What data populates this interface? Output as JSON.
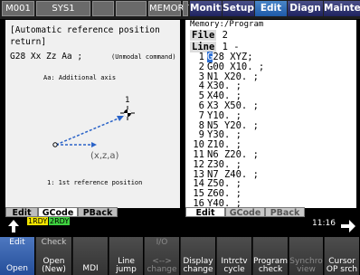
{
  "topbar": {
    "machine": "M001",
    "system": "SYS1",
    "memory": "MEMORY",
    "tabs": [
      "Monitr",
      "Setup",
      "Edit",
      "Diagn",
      "Mainte"
    ],
    "active_tab": "Edit"
  },
  "guide": {
    "title_line1": "[Automatic reference position",
    "title_line2": "return]",
    "syntax": "G28 Xx Zz Aa ;",
    "modal_note": "(Unmodal command)",
    "axis_note": "Aa: Additional axis",
    "point_label": "1",
    "coord_label": "(x,z,a)",
    "ref_note": "1: 1st reference position"
  },
  "program": {
    "header": "Memory:/Program",
    "file_label": "File",
    "file_value": "2",
    "line_label": "Line",
    "line_value": "1 -",
    "lines": [
      {
        "n": "1",
        "code": "G28 XYZ;"
      },
      {
        "n": "2",
        "code": "G00 X10. ;"
      },
      {
        "n": "3",
        "code": "N1 X20. ;"
      },
      {
        "n": "4",
        "code": "X30. ;"
      },
      {
        "n": "5",
        "code": "X40. ;"
      },
      {
        "n": "6",
        "code": "X3 X50. ;"
      },
      {
        "n": "7",
        "code": "Y10. ;"
      },
      {
        "n": "8",
        "code": "N5 Y20. ;"
      },
      {
        "n": "9",
        "code": "Y30. ;"
      },
      {
        "n": "10",
        "code": "Z10. ;"
      },
      {
        "n": "11",
        "code": "N6 Z20. ;"
      },
      {
        "n": "12",
        "code": "Z30. ;"
      },
      {
        "n": "13",
        "code": "N7 Z40. ;"
      },
      {
        "n": "14",
        "code": "Z50. ;"
      },
      {
        "n": "15",
        "code": "Z60. ;"
      },
      {
        "n": "16",
        "code": "Y40. ;"
      }
    ]
  },
  "left_tabs": [
    "Edit",
    "GCode",
    "PBack"
  ],
  "right_tabs": [
    "Edit",
    "GCode",
    "PBack"
  ],
  "status": {
    "rdy1": "1RDY",
    "rdy2": "2RDY",
    "time": "11:16"
  },
  "fkeys": [
    {
      "top": "Edit",
      "bottom": "Open"
    },
    {
      "top": "Check",
      "bottom": "Open (New)"
    },
    {
      "top": "",
      "bottom": "MDI"
    },
    {
      "top": "",
      "bottom": "Line jump"
    },
    {
      "top": "I/O",
      "bottom": "<--> change"
    },
    {
      "top": "",
      "bottom": "Display change"
    },
    {
      "top": "",
      "bottom": "Intrctv cycle"
    },
    {
      "top": "",
      "bottom": "Program check"
    },
    {
      "top": "",
      "bottom": "Synchro view"
    },
    {
      "top": "",
      "bottom": "Cursor OP srch"
    }
  ],
  "colors": {
    "tab_active": "#2e6fc0",
    "tab_inactive": "#2a2f70",
    "rdy1": "#f2e400",
    "rdy2": "#3ed13e",
    "fkey_highlight": "#3563b0"
  }
}
